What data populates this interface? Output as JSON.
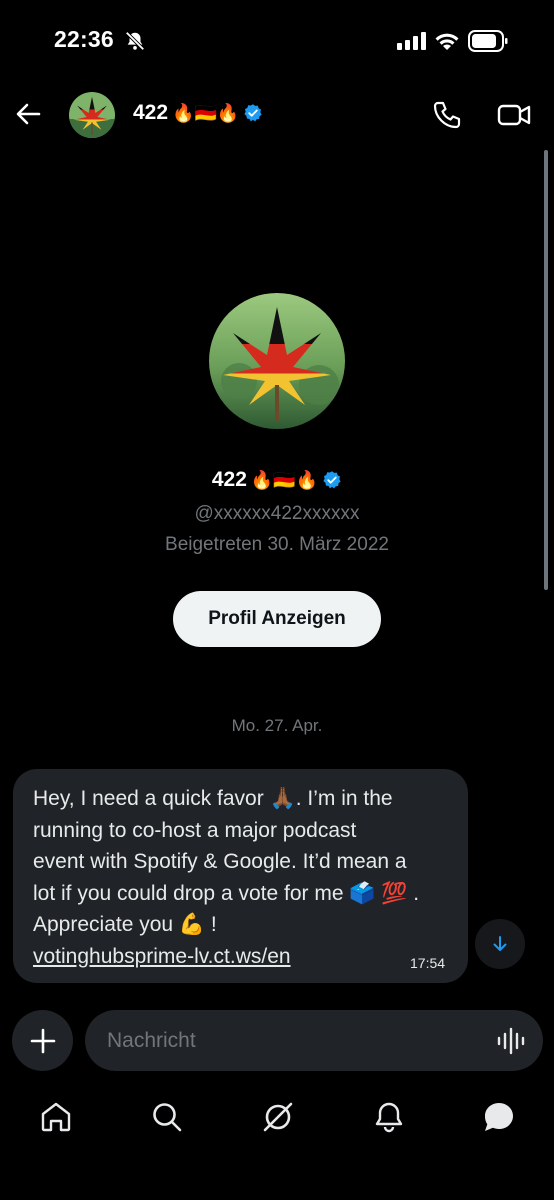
{
  "status_bar": {
    "time": "22:36"
  },
  "header": {
    "name": "422",
    "name_emoji": "🔥🇩🇪🔥",
    "verified_color": "#1d9bf0"
  },
  "profile": {
    "name": "422",
    "name_emoji": "🔥🇩🇪🔥",
    "handle": "@xxxxxx422xxxxxx",
    "joined": "Beigetreten 30. März 2022",
    "button_label": "Profil Anzeigen"
  },
  "conversation": {
    "date_separator": "Mo. 27. Apr.",
    "message": {
      "line1": "Hey, I need a quick favor 🙏🏾. I’m in the",
      "line2": "running to co-host a major podcast",
      "line3": "event with Spotify & Google. It’d mean a",
      "line4": "lot if you could drop a vote for me 🗳️ 💯 .",
      "line5": "Appreciate you 💪 !",
      "link": "votinghubsprime-lv.ct.ws/en",
      "time": "17:54"
    }
  },
  "composer": {
    "placeholder": "Nachricht"
  },
  "nav": [
    "home-icon",
    "search-icon",
    "grok-icon",
    "notifications-icon",
    "messages-icon"
  ],
  "colors": {
    "background": "#000000",
    "bubble": "#202327",
    "muted": "#71767b",
    "accent": "#1d9bf0"
  }
}
